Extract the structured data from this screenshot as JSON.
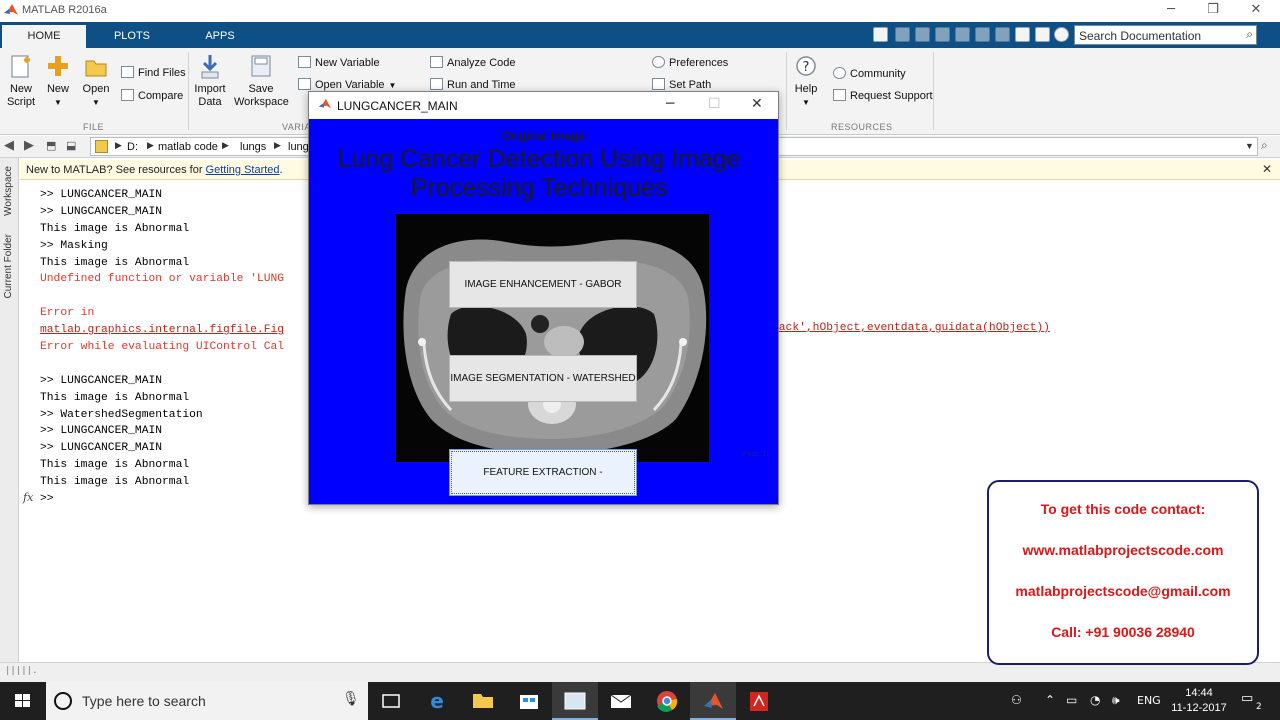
{
  "window": {
    "title": "MATLAB R2016a",
    "minimize": "─",
    "maximize": "❐",
    "close": "✕"
  },
  "ribbon": {
    "tabs": [
      "HOME",
      "PLOTS",
      "APPS"
    ],
    "search_placeholder": "Search Documentation",
    "buttons": {
      "new_script": "New\nScript",
      "new": "New",
      "open": "Open",
      "find_files": "Find Files",
      "compare": "Compare",
      "import_data": "Import\nData",
      "save_workspace": "Save\nWorkspace",
      "new_variable": "New Variable",
      "open_variable": "Open Variable",
      "analyze_code": "Analyze Code",
      "run_and_time": "Run and Time",
      "preferences": "Preferences",
      "set_path": "Set Path",
      "help": "Help",
      "community": "Community",
      "request_support": "Request Support"
    },
    "sections": {
      "file": "FILE",
      "variable": "VARIA",
      "resources": "RESOURCES"
    }
  },
  "address": {
    "crumbs": [
      "D:",
      "matlab code",
      "lungs",
      "lung"
    ]
  },
  "side_dock": {
    "workspace": "Workspace",
    "current_folder": "Current Folder"
  },
  "command_window": {
    "info_prefix": "New to MATLAB? See resources for ",
    "info_link": "Getting Started",
    "info_suffix": ".",
    "lines": [
      {
        "text": ">> LUNGCANCER_MAIN",
        "kind": "normal"
      },
      {
        "text": ">> LUNGCANCER_MAIN",
        "kind": "normal"
      },
      {
        "text": "This image is Abnormal",
        "kind": "normal"
      },
      {
        "text": ">> Masking",
        "kind": "normal"
      },
      {
        "text": "This image is Abnormal",
        "kind": "normal"
      },
      {
        "text": "Undefined function or variable 'LUNG",
        "kind": "err"
      },
      {
        "text": "",
        "kind": "normal"
      },
      {
        "text": "Error in",
        "kind": "err"
      },
      {
        "text": "matlab.graphics.internal.figfile.Fig",
        "kind": "link"
      },
      {
        "text": "Error while evaluating UIControl Cal",
        "kind": "err"
      },
      {
        "text": "",
        "kind": "normal"
      },
      {
        "text": ">> LUNGCANCER_MAIN",
        "kind": "normal"
      },
      {
        "text": "This image is Abnormal",
        "kind": "normal"
      },
      {
        "text": ">> WatershedSegmentation",
        "kind": "normal"
      },
      {
        "text": ">> LUNGCANCER_MAIN",
        "kind": "normal"
      },
      {
        "text": ">> LUNGCANCER_MAIN",
        "kind": "normal"
      },
      {
        "text": "This image is Abnormal",
        "kind": "normal"
      },
      {
        "text": "This image is Abnormal",
        "kind": "normal"
      },
      {
        "text": ">>",
        "kind": "normal"
      }
    ],
    "error_trail": "back',hObject,eventdata,guidata(hObject))",
    "fx": "fx"
  },
  "figure": {
    "title": "LUNGCANCER_MAIN",
    "original_label": "Original Image",
    "headline": "Lung Cancer Detection Using Image Processing Techniques",
    "buttons": [
      "IMAGE ENHANCEMENT - GABOR",
      "IMAGE SEGMENTATION - WATERSHED",
      "FEATURE EXTRACTION - BINARIZATION"
    ],
    "tiny_label": "Pass: 1L"
  },
  "contact": {
    "heading": "To get this code contact:",
    "website": "www.matlabprojectscode.com",
    "email": "matlabprojectscode@gmail.com",
    "phone": "Call: +91 90036 28940"
  },
  "taskbar": {
    "search_placeholder": "Type here to search",
    "language": "ENG",
    "time": "14:44",
    "date": "11-12-2017",
    "notifications": "2"
  },
  "colors": {
    "ribbon_tab_bg": "#0e4f85",
    "figure_bg": "#0000ff",
    "error_red": "#e8362b",
    "contact_red": "#e01515"
  }
}
